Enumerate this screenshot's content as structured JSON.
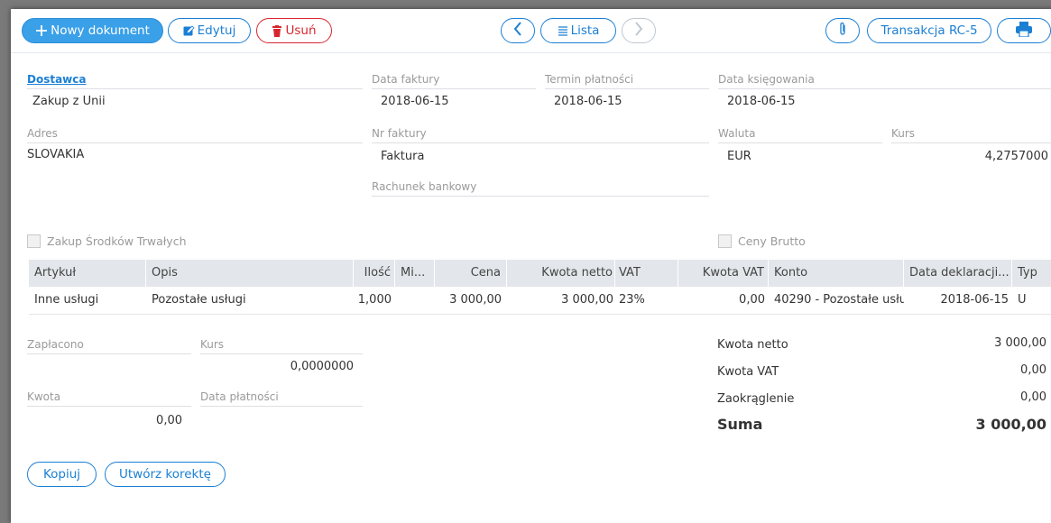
{
  "toolbar": {
    "new_document": "Nowy dokument",
    "edit": "Edytuj",
    "delete": "Usuń",
    "list": "Lista",
    "transaction": "Transakcja RC-5"
  },
  "header": {
    "supplier_label": "Dostawca",
    "supplier_value": "Zakup z Unii",
    "invoice_date_label": "Data faktury",
    "invoice_date_value": "2018-06-15",
    "payment_term_label": "Termin płatności",
    "payment_term_value": "2018-06-15",
    "posting_date_label": "Data księgowania",
    "posting_date_value": "2018-06-15",
    "address_label": "Adres",
    "address_value": "SLOVAKIA",
    "invoice_no_label": "Nr faktury",
    "invoice_no_value": "Faktura",
    "currency_label": "Waluta",
    "currency_value": "EUR",
    "rate_label": "Kurs",
    "rate_value": "4,2757000",
    "bank_account_label": "Rachunek bankowy",
    "bank_account_value": ""
  },
  "checkboxes": {
    "fixed_assets": "Zakup Środków Trwałych",
    "gross_prices": "Ceny Brutto"
  },
  "table": {
    "columns": [
      "Artykuł",
      "Opis",
      "Ilość",
      "Mi...",
      "Cena",
      "Kwota netto",
      "VAT",
      "Kwota VAT",
      "Konto",
      "Data deklaracji...",
      "Typ"
    ],
    "rows": [
      [
        "Inne usługi",
        "Pozostałe usługi",
        "1,000",
        "",
        "3 000,00",
        "3 000,00",
        "23%",
        "0,00",
        "40290 - Pozostałe usłu",
        "2018-06-15",
        "U"
      ]
    ]
  },
  "payment": {
    "paid_label": "Zapłacono",
    "paid_value": "",
    "rate_label": "Kurs",
    "rate_value": "0,0000000",
    "amount_label": "Kwota",
    "amount_value": "0,00",
    "pay_date_label": "Data płatności",
    "pay_date_value": ""
  },
  "summary": {
    "net_label": "Kwota netto",
    "net_value": "3 000,00",
    "vat_label": "Kwota VAT",
    "vat_value": "0,00",
    "rounding_label": "Zaokrąglenie",
    "rounding_value": "0,00",
    "total_label": "Suma",
    "total_value": "3 000,00"
  },
  "footer": {
    "copy": "Kopiuj",
    "correction": "Utwórz korektę"
  },
  "colors": {
    "accent": "#1b7fd4",
    "primary_button": "#3aa0e8",
    "danger": "#d8262f",
    "grid_header": "#e3e6ea"
  },
  "icons": [
    "plus-icon",
    "edit-icon",
    "trash-icon",
    "chevron-left-icon",
    "list-icon",
    "chevron-right-icon",
    "paperclip-icon",
    "printer-icon"
  ]
}
